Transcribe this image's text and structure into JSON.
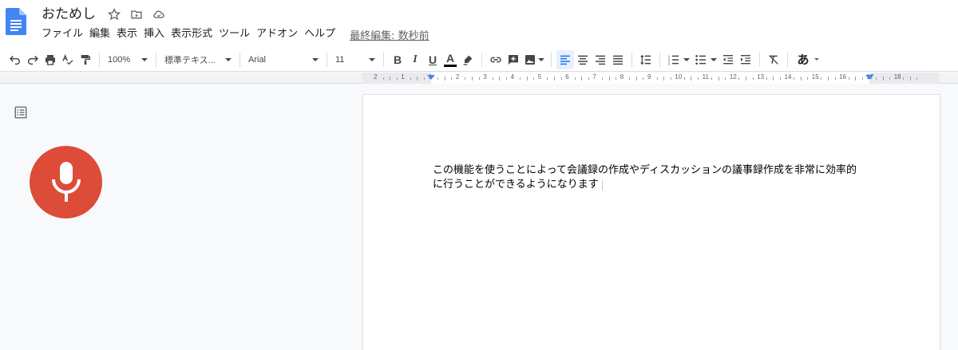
{
  "header": {
    "title": "おためし",
    "menu": [
      "ファイル",
      "編集",
      "表示",
      "挿入",
      "表示形式",
      "ツール",
      "アドオン",
      "ヘルプ"
    ],
    "last_edit": "最終編集: 数秒前"
  },
  "toolbar": {
    "zoom": "100%",
    "style": "標準テキス...",
    "font": "Arial",
    "size": "11",
    "bold": "B",
    "italic": "I",
    "underline": "U",
    "text_color": "A",
    "input_method": "あ"
  },
  "ruler": {
    "numbers": [
      "2",
      "1",
      "1",
      "2",
      "3",
      "4",
      "5",
      "6",
      "7",
      "8",
      "9",
      "10",
      "11",
      "12",
      "13",
      "14",
      "15",
      "16",
      "17",
      "18"
    ]
  },
  "document": {
    "lines": [
      "この機能を使うことによって会議録の作成やディスカッションの議事録作成を非常に効率的",
      "に行うことができるようになります"
    ]
  },
  "colors": {
    "mic": "#dd4b39",
    "accent": "#4285f4",
    "doc_icon": "#4285f4"
  }
}
